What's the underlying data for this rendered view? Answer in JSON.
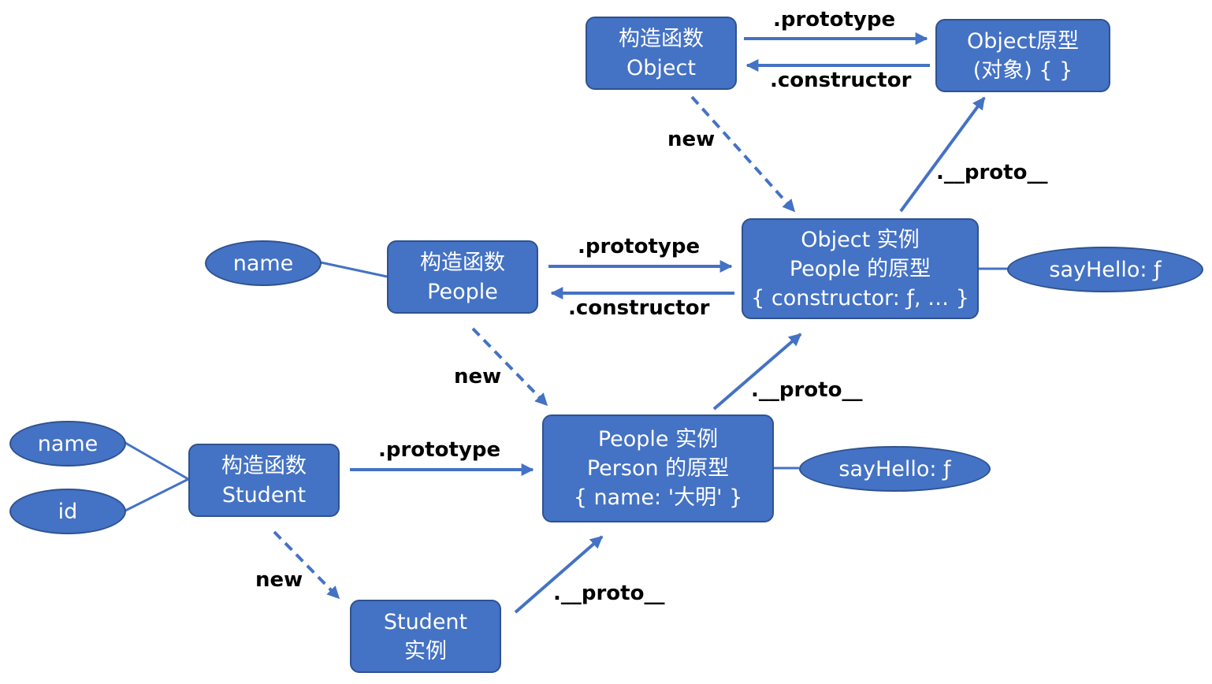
{
  "colors": {
    "box_fill": "#4472c4",
    "box_border": "#2f528f",
    "arrow": "#4472c4",
    "label_text": "#000000",
    "node_text": "#ffffff"
  },
  "nodes": {
    "object_ctor": {
      "line1": "构造函数",
      "line2": "Object"
    },
    "object_proto": {
      "line1": "Object原型",
      "line2": "(对象) { }"
    },
    "people_ctor": {
      "line1": "构造函数",
      "line2": "People"
    },
    "object_instance": {
      "line1": "Object 实例",
      "line2": "People 的原型",
      "line3": "{ constructor: ƒ, … }"
    },
    "student_ctor": {
      "line1": "构造函数",
      "line2": "Student"
    },
    "people_instance": {
      "line1": "People 实例",
      "line2": "Person 的原型",
      "line3": "{ name: '大明' }"
    },
    "student_instance": {
      "line1": "Student",
      "line2": "实例"
    }
  },
  "properties": {
    "people_name": "name",
    "object_instance_sayhello": "sayHello: ƒ",
    "student_name": "name",
    "student_id": "id",
    "people_instance_sayhello": "sayHello: ƒ"
  },
  "edge_labels": {
    "object_prototype": ".prototype",
    "object_constructor": ".constructor",
    "object_new": "new",
    "object_instance_proto": ".__proto__",
    "people_prototype": ".prototype",
    "people_constructor": ".constructor",
    "people_new": "new",
    "people_instance_proto": ".__proto__",
    "student_prototype": ".prototype",
    "student_new": "new",
    "student_instance_proto": ".__proto__"
  }
}
